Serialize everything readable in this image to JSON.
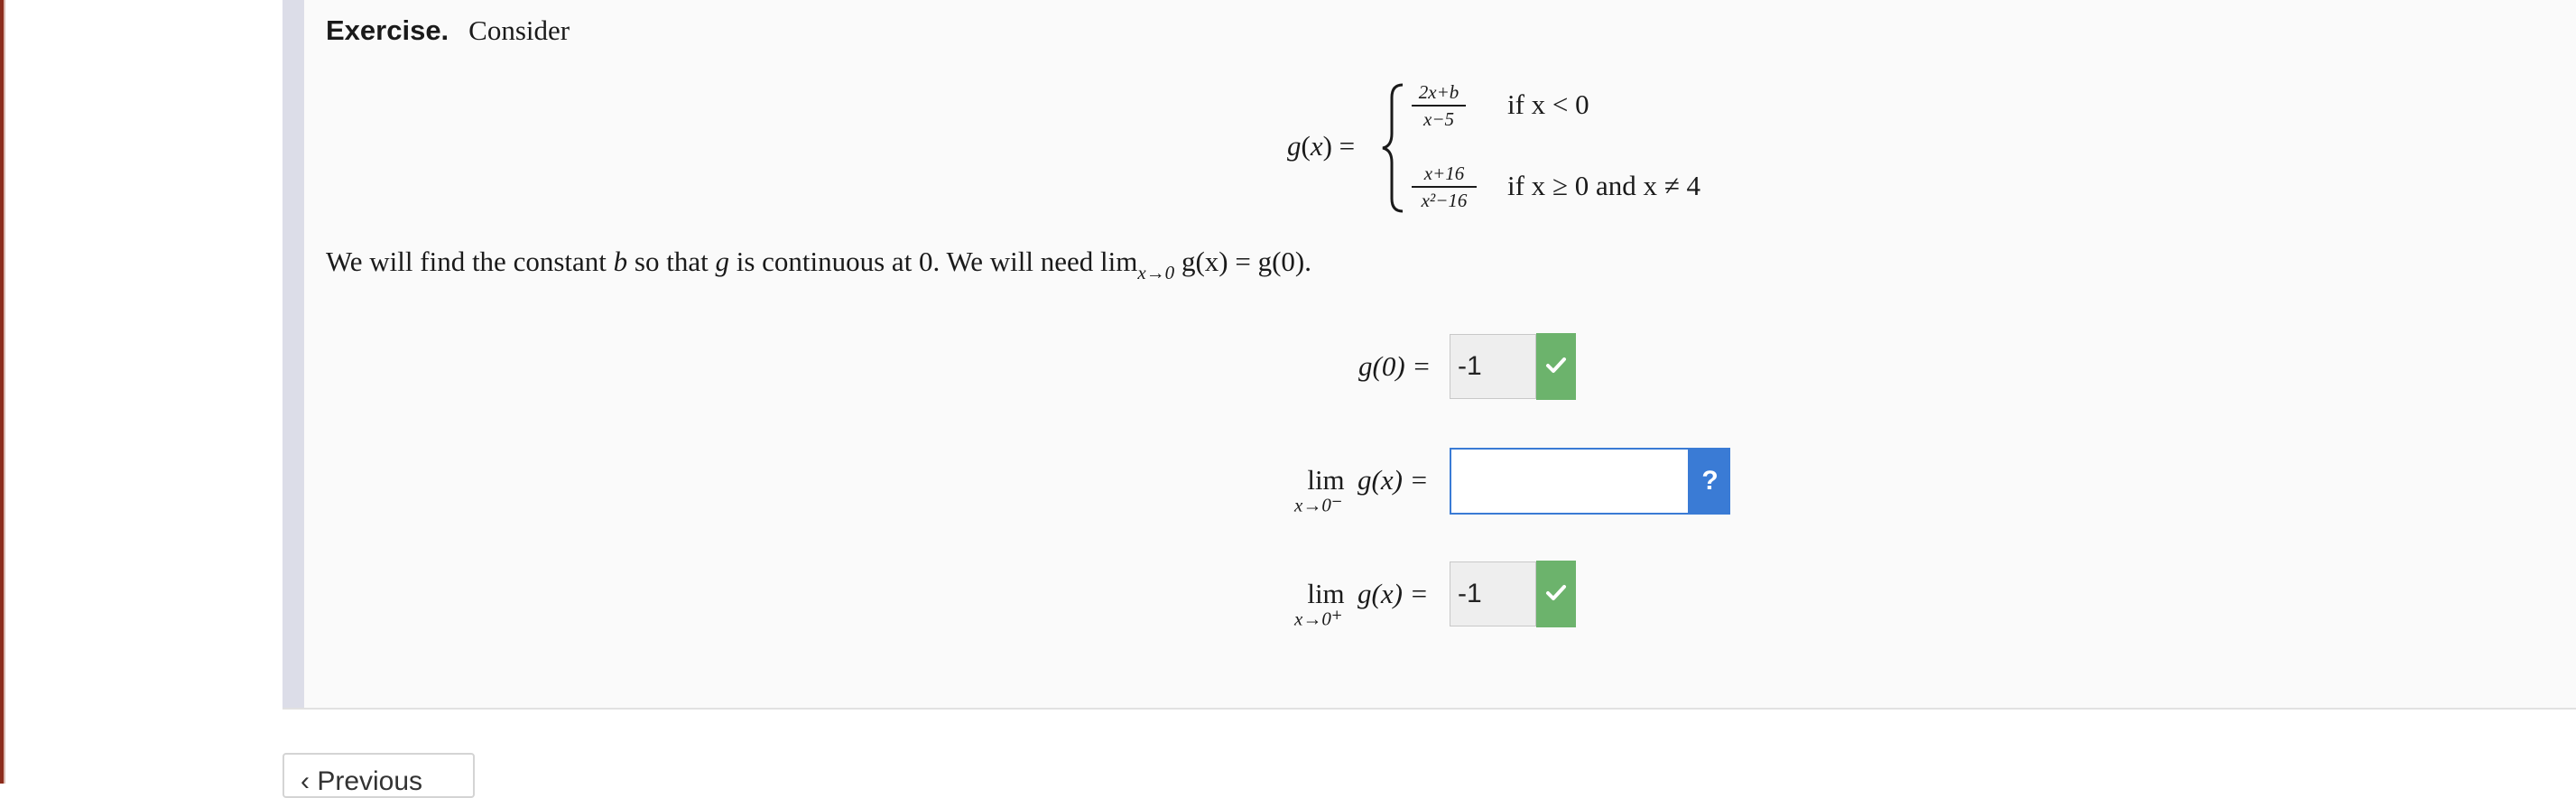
{
  "exercise": {
    "heading": "Exercise.",
    "intro": "Consider"
  },
  "piecewise": {
    "lhs_func": "g",
    "lhs_var": "x",
    "case1_num": "2x+b",
    "case1_den": "x−5",
    "case1_cond": "if x < 0",
    "case2_num": "x+16",
    "case2_den": "x²−16",
    "case2_cond": "if x ≥ 0 and x ≠ 4"
  },
  "sentence": {
    "part1": "We will find the constant ",
    "var_b": "b",
    "part2": " so that ",
    "var_g": "g",
    "part3": " is continuous at 0. We will need lim",
    "lim_sub": "x→0",
    "part4": " g(x) = g(0)."
  },
  "questions": [
    {
      "label": "g(0) =",
      "answer": "-1",
      "status": "correct"
    },
    {
      "lim_word": "lim",
      "lim_sub": "x→0",
      "lim_sup": "−",
      "label": "g(x) =",
      "answer": "",
      "status": "unanswered",
      "help_label": "?"
    },
    {
      "lim_word": "lim",
      "lim_sub": "x→0",
      "lim_sup": "+",
      "label": "g(x) =",
      "answer": "-1",
      "status": "correct"
    }
  ],
  "navigation": {
    "previous_label": "‹ Previous"
  },
  "colors": {
    "correct": "#6cb36c",
    "help": "#3a7bd5",
    "panel_bar": "#dcdde8"
  },
  "icons": {
    "correct": "check-icon"
  }
}
